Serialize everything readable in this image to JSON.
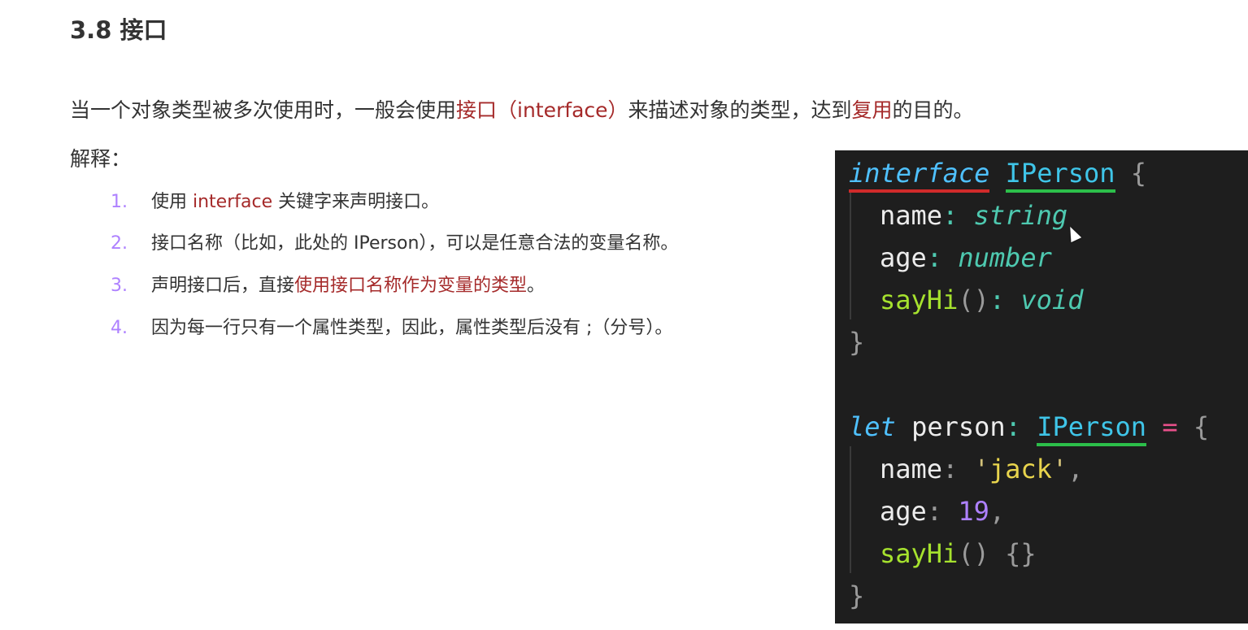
{
  "section": {
    "title": "3.8 接口"
  },
  "intro": {
    "part1": "当一个对象类型被多次使用时，一般会使用",
    "hl1": "接口（interface）",
    "part2": "来描述对象的类型，达到",
    "hl2": "复用",
    "part3": "的目的。"
  },
  "explain_label": "解释：",
  "items": [
    {
      "num": "1.",
      "pre": "使用 ",
      "hl": "interface",
      "post": " 关键字来声明接口。"
    },
    {
      "num": "2.",
      "pre": "接口名称（比如，此处的 IPerson），可以是任意合法的变量名称。",
      "hl": "",
      "post": ""
    },
    {
      "num": "3.",
      "pre": "声明接口后，直接",
      "hl": "使用接口名称作为变量的类型",
      "post": "。"
    },
    {
      "num": "4.",
      "pre": "因为每一行只有一个属性类型，因此，属性类型后没有 ;（分号）。",
      "hl": "",
      "post": ""
    }
  ],
  "code": {
    "kw_interface": "interface",
    "iface_name": "IPerson",
    "brace_open": "{",
    "brace_close": "}",
    "p_name": "name",
    "p_age": "age",
    "p_sayhi": "sayHi",
    "parens": "()",
    "colon": ":",
    "t_string": "string",
    "t_number": "number",
    "t_void": "void",
    "kw_let": "let",
    "var_name": "person",
    "eq": "=",
    "val_name": "jack",
    "quote": "'",
    "comma": ",",
    "val_age": "19",
    "empty_body": "{}"
  }
}
